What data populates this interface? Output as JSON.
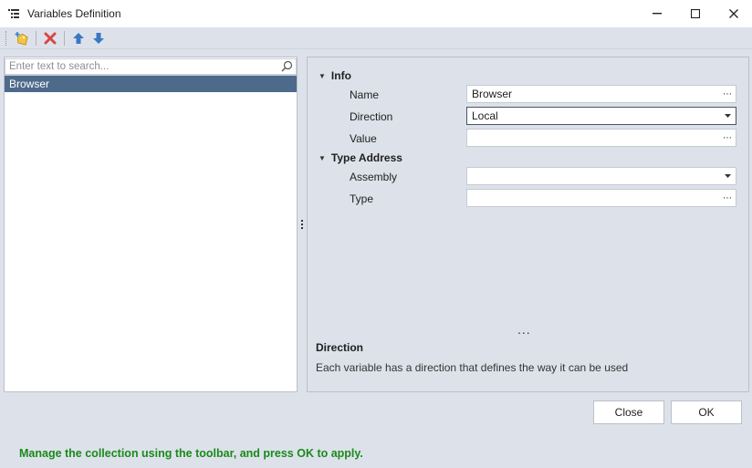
{
  "window": {
    "title": "Variables Definition",
    "icon": "list-icon",
    "controls": {
      "minimize": "–",
      "maximize": "☐",
      "close": "✕"
    }
  },
  "toolbar": {
    "items": [
      {
        "name": "add-variable-button",
        "icon": "tag-add-icon"
      },
      {
        "name": "delete-variable-button",
        "icon": "delete-x-icon"
      },
      {
        "name": "move-up-button",
        "icon": "arrow-up-icon"
      },
      {
        "name": "move-down-button",
        "icon": "arrow-down-icon"
      }
    ]
  },
  "search": {
    "placeholder": "Enter text to search...",
    "value": ""
  },
  "variables": [
    "Browser"
  ],
  "selected_variable": "Browser",
  "properties": {
    "groups": [
      {
        "title": "Info",
        "rows": [
          {
            "label": "Name",
            "value": "Browser",
            "editor": "ellipsis"
          },
          {
            "label": "Direction",
            "value": "Local",
            "editor": "dropdown"
          },
          {
            "label": "Value",
            "value": "",
            "editor": "ellipsis"
          }
        ]
      },
      {
        "title": "Type Address",
        "rows": [
          {
            "label": "Assembly",
            "value": "",
            "editor": "dropdown"
          },
          {
            "label": "Type",
            "value": "",
            "editor": "ellipsis"
          }
        ]
      }
    ]
  },
  "description": {
    "splitter": "...",
    "title": "Direction",
    "text": "Each variable has a direction that defines the way it can be used"
  },
  "buttons": {
    "close": "Close",
    "ok": "OK"
  },
  "status_text": "Manage the collection using the toolbar, and press OK to apply.",
  "colors": {
    "selection": "#4e6a8a",
    "status_green": "#1a8a1a",
    "panel_bg": "#dde2ea",
    "arrow_blue": "#3b78c3",
    "delete_red": "#d94646"
  }
}
